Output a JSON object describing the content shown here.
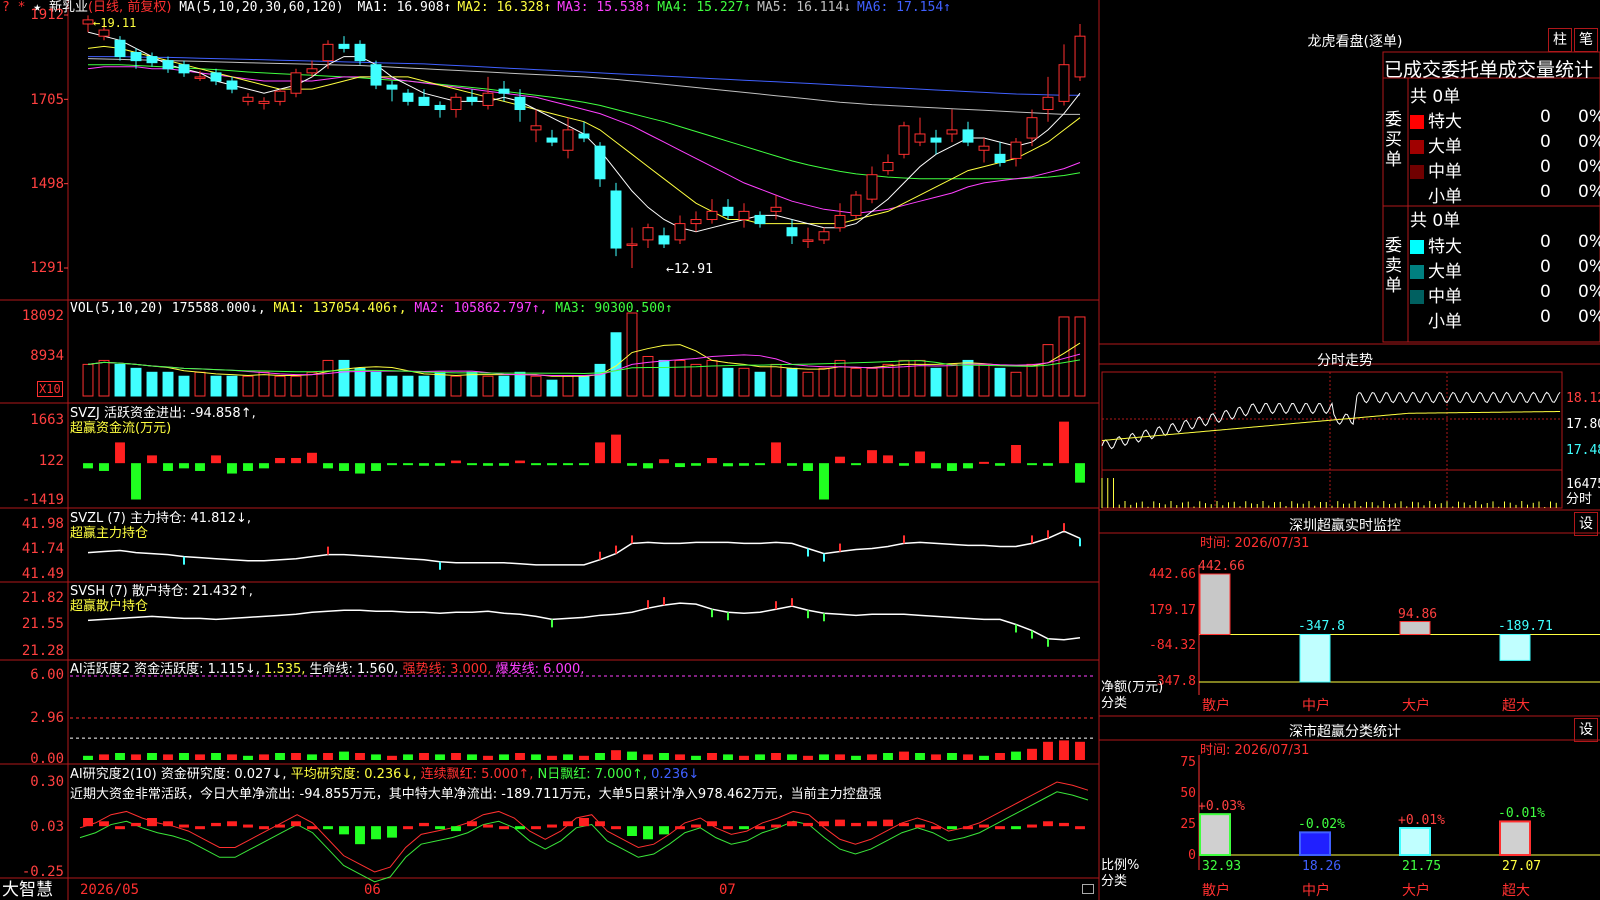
{
  "stock": {
    "name": "新乳业",
    "period": "(日线, 前复权)",
    "star": "★",
    "marks": "?  *"
  },
  "main_pane": {
    "ma_label": "MA(5,10,20,30,60,120)",
    "ma": [
      {
        "label": "MA1:",
        "value": "16.908↑",
        "color": "#ffffff"
      },
      {
        "label": "MA2:",
        "value": "16.328↑",
        "color": "#ffff40"
      },
      {
        "label": "MA3:",
        "value": "15.538↑",
        "color": "#ff40ff"
      },
      {
        "label": "MA4:",
        "value": "15.227↑",
        "color": "#40ff40"
      },
      {
        "label": "MA5:",
        "value": "16.114↓",
        "color": "#c0c0c0"
      },
      {
        "label": "MA6:",
        "value": "17.154↑",
        "color": "#4060ff"
      }
    ],
    "y_ticks": [
      "1912",
      "1705",
      "1498",
      "1291"
    ],
    "high_note": "19.11",
    "low_note": "←12.91"
  },
  "vol_pane": {
    "label": "VOL(5,10,20)",
    "value": "175588.000↓,",
    "ma1": "MA1: 137054.406↑,",
    "ma2": "MA2: 105862.797↑,",
    "ma3": "MA3: 90300.500↑",
    "y_ticks": [
      "18092",
      "8934"
    ],
    "unit": "X10"
  },
  "svzj_pane": {
    "line1": "SVZJ  活跃资金进出: -94.858↑,",
    "line2": "超赢资金流(万元)",
    "y_ticks": [
      "1663",
      "122",
      "-1419"
    ]
  },
  "svzl_pane": {
    "line1": "SVZL (7) 主力持仓: 41.812↓,",
    "line2": "超赢主力持仓",
    "y_ticks": [
      "41.98",
      "41.74",
      "41.49"
    ]
  },
  "svsh_pane": {
    "line1": "SVSH (7) 散户持仓: 21.432↑,",
    "line2": "超赢散户持仓",
    "y_ticks": [
      "21.82",
      "21.55",
      "21.28"
    ]
  },
  "ai1_pane": {
    "name": "AI活跃度2 资金活跃度: ",
    "v1": "1.115↓,",
    "v2": "1.535,",
    "life": "生命线: 1.560,",
    "strong": "强势线: 3.000,",
    "burst": "爆发线: 6.000,",
    "y_ticks": [
      "6.00",
      "2.96",
      "0.00"
    ]
  },
  "ai2_pane": {
    "name": "AI研究度2(10) 资金研究度: 0.027↓,",
    "avg": "平均研究度: 0.236↓,",
    "consecutive": "连续飘红: 5.000↑,",
    "nday": "N日飘红: 7.000↑,",
    "last": "0.236↓",
    "comment": "近期大资金非常活跃，今日大单净流出: -94.855万元，其中特大单净流出: -189.711万元，大单5日累计净入978.462万元，当前主力控盘强",
    "y_ticks": [
      "0.30",
      "0.03",
      "-0.25"
    ]
  },
  "footer": {
    "brand": "大智慧",
    "dates": [
      "2026/05",
      "06",
      "07"
    ]
  },
  "right_panel": {
    "lhb_title": "龙虎看盘(逐单)",
    "btn_bar": "柱",
    "btn_pen": "笔",
    "tabs_label": "已成交委托单成交量统计",
    "buy_label": "委买单",
    "sell_label": "委卖单",
    "buy_total": "共 0单",
    "sell_total": "共 0单",
    "buy_rows": [
      {
        "name": "特大",
        "count": "0",
        "pct": "0%",
        "color": "#ff0000"
      },
      {
        "name": "大单",
        "count": "0",
        "pct": "0%",
        "color": "#a00000"
      },
      {
        "name": "中单",
        "count": "0",
        "pct": "0%",
        "color": "#700000"
      },
      {
        "name": "小单",
        "count": "0",
        "pct": "0%",
        "color": "#000000"
      }
    ],
    "sell_rows": [
      {
        "name": "特大",
        "count": "0",
        "pct": "0%",
        "color": "#00ffff"
      },
      {
        "name": "大单",
        "count": "0",
        "pct": "0%",
        "color": "#008080"
      },
      {
        "name": "中单",
        "count": "0",
        "pct": "0%",
        "color": "#006060"
      },
      {
        "name": "小单",
        "count": "0",
        "pct": "0%",
        "color": "#000000"
      }
    ],
    "intraday_title": "分时走势",
    "intraday_ticks": [
      "18.12",
      "17.80",
      "17.48",
      "16475"
    ],
    "intraday_unit": "分时",
    "sz_title": "深圳超赢实时监控",
    "sz_setting": "设",
    "sz_time": "时间: 2026/07/31",
    "sz_ticks": [
      "442.66",
      "179.17",
      "-84.32",
      "-347.8"
    ],
    "sz_ylabel": "净额(万元)",
    "sz_xlabel": "分类",
    "sz_bars": [
      {
        "cat": "散户",
        "value": 442.66,
        "label": "442.66"
      },
      {
        "cat": "中户",
        "value": -347.8,
        "label": "-347.8"
      },
      {
        "cat": "大户",
        "value": 94.86,
        "label": "94.86"
      },
      {
        "cat": "超大",
        "value": -189.71,
        "label": "-189.71"
      }
    ],
    "cls_title": "深市超赢分类统计",
    "cls_setting": "设",
    "cls_time": "时间: 2026/07/31",
    "cls_ticks": [
      "75",
      "50",
      "25",
      "0"
    ],
    "cls_ylabel": "比例%",
    "cls_xlabel": "分类",
    "cls_bars": [
      {
        "cat": "散户",
        "value": 32.93,
        "delta": "+0.03%"
      },
      {
        "cat": "中户",
        "value": 18.26,
        "delta": "-0.02%"
      },
      {
        "cat": "大户",
        "value": 21.75,
        "delta": "+0.01%"
      },
      {
        "cat": "超大",
        "value": 27.07,
        "delta": "-0.01%"
      }
    ]
  },
  "chart_data": {
    "type": "candlestick",
    "candles": [
      [
        18.9,
        19.11,
        18.7,
        19.0
      ],
      [
        18.6,
        18.9,
        18.5,
        18.75
      ],
      [
        18.5,
        18.6,
        18.0,
        18.1
      ],
      [
        18.2,
        18.3,
        17.8,
        18.0
      ],
      [
        18.1,
        18.2,
        17.85,
        17.95
      ],
      [
        18.0,
        18.1,
        17.7,
        17.8
      ],
      [
        17.9,
        18.0,
        17.6,
        17.7
      ],
      [
        17.6,
        17.75,
        17.5,
        17.6
      ],
      [
        17.7,
        17.8,
        17.4,
        17.5
      ],
      [
        17.5,
        17.6,
        17.2,
        17.3
      ],
      [
        17.0,
        17.2,
        16.9,
        17.1
      ],
      [
        16.95,
        17.1,
        16.8,
        17.0
      ],
      [
        17.0,
        17.3,
        16.9,
        17.25
      ],
      [
        17.2,
        17.8,
        17.1,
        17.7
      ],
      [
        17.7,
        18.0,
        17.6,
        17.8
      ],
      [
        18.0,
        18.5,
        17.8,
        18.4
      ],
      [
        18.4,
        18.6,
        18.2,
        18.3
      ],
      [
        18.4,
        18.5,
        17.9,
        18.0
      ],
      [
        17.9,
        18.0,
        17.3,
        17.4
      ],
      [
        17.4,
        17.5,
        17.0,
        17.3
      ],
      [
        17.2,
        17.3,
        16.9,
        17.0
      ],
      [
        17.1,
        17.3,
        16.9,
        16.9
      ],
      [
        16.9,
        17.0,
        16.6,
        16.8
      ],
      [
        16.8,
        17.2,
        16.6,
        17.1
      ],
      [
        17.1,
        17.3,
        16.9,
        17.0
      ],
      [
        16.9,
        17.6,
        16.8,
        17.2
      ],
      [
        17.3,
        17.5,
        17.0,
        17.2
      ],
      [
        17.1,
        17.3,
        16.5,
        16.8
      ],
      [
        16.3,
        16.8,
        16.0,
        16.4
      ],
      [
        16.1,
        16.3,
        15.9,
        16.0
      ],
      [
        15.8,
        16.6,
        15.6,
        16.3
      ],
      [
        16.2,
        16.5,
        16.0,
        16.1
      ],
      [
        15.9,
        16.0,
        14.9,
        15.1
      ],
      [
        14.8,
        15.0,
        13.2,
        13.4
      ],
      [
        13.5,
        13.9,
        12.91,
        13.5
      ],
      [
        13.6,
        14.0,
        13.4,
        13.9
      ],
      [
        13.7,
        13.9,
        13.4,
        13.5
      ],
      [
        13.6,
        14.2,
        13.5,
        14.0
      ],
      [
        14.0,
        14.3,
        13.8,
        14.1
      ],
      [
        14.1,
        14.6,
        14.0,
        14.3
      ],
      [
        14.4,
        14.6,
        14.1,
        14.2
      ],
      [
        14.1,
        14.5,
        13.9,
        14.3
      ],
      [
        14.2,
        14.3,
        13.9,
        14.0
      ],
      [
        14.3,
        14.7,
        14.1,
        14.4
      ],
      [
        13.9,
        14.1,
        13.5,
        13.7
      ],
      [
        13.6,
        13.9,
        13.4,
        13.6
      ],
      [
        13.6,
        13.9,
        13.5,
        13.8
      ],
      [
        13.9,
        14.5,
        13.8,
        14.2
      ],
      [
        14.2,
        14.8,
        14.1,
        14.7
      ],
      [
        14.6,
        15.4,
        14.5,
        15.2
      ],
      [
        15.3,
        15.7,
        15.2,
        15.5
      ],
      [
        15.7,
        16.5,
        15.6,
        16.4
      ],
      [
        16.0,
        16.6,
        15.9,
        16.2
      ],
      [
        16.1,
        16.3,
        15.7,
        16.0
      ],
      [
        16.2,
        16.8,
        16.0,
        16.3
      ],
      [
        16.3,
        16.5,
        15.9,
        16.0
      ],
      [
        15.8,
        16.1,
        15.5,
        15.9
      ],
      [
        15.7,
        16.0,
        15.4,
        15.5
      ],
      [
        15.6,
        16.1,
        15.4,
        16.0
      ],
      [
        16.1,
        16.8,
        15.9,
        16.6
      ],
      [
        16.8,
        17.6,
        16.5,
        17.1
      ],
      [
        17.0,
        18.4,
        16.9,
        17.9
      ],
      [
        17.6,
        18.9,
        17.5,
        18.6
      ]
    ],
    "ma5": [
      18.7,
      18.6,
      18.5,
      18.3,
      18.1,
      17.9,
      17.8,
      17.7,
      17.5,
      17.4,
      17.3,
      17.2,
      17.3,
      17.4,
      17.6,
      17.9,
      18.1,
      18.1,
      17.9,
      17.6,
      17.4,
      17.2,
      17.1,
      17.0,
      17.0,
      17.0,
      17.1,
      17.0,
      16.8,
      16.6,
      16.4,
      16.2,
      15.8,
      15.3,
      14.8,
      14.4,
      14.1,
      13.9,
      13.8,
      13.9,
      14.0,
      14.1,
      14.2,
      14.2,
      14.1,
      14.0,
      13.9,
      13.9,
      14.0,
      14.3,
      14.6,
      15.0,
      15.4,
      15.7,
      15.9,
      16.1,
      16.1,
      16.0,
      15.9,
      16.0,
      16.3,
      16.7,
      17.2
    ],
    "ma10": [
      18.3,
      18.35,
      18.3,
      18.2,
      18.1,
      18.0,
      17.9,
      17.8,
      17.7,
      17.6,
      17.5,
      17.4,
      17.3,
      17.3,
      17.3,
      17.4,
      17.5,
      17.6,
      17.6,
      17.6,
      17.6,
      17.5,
      17.4,
      17.3,
      17.2,
      17.1,
      17.0,
      16.9,
      16.8,
      16.7,
      16.6,
      16.5,
      16.3,
      16.0,
      15.7,
      15.4,
      15.1,
      14.8,
      14.5,
      14.3,
      14.1,
      14.1,
      14.0,
      14.0,
      14.0,
      14.0,
      14.0,
      14.0,
      14.1,
      14.2,
      14.3,
      14.5,
      14.7,
      14.9,
      15.1,
      15.3,
      15.4,
      15.5,
      15.6,
      15.8,
      16.0,
      16.3,
      16.6
    ],
    "ma20": [
      17.8,
      17.85,
      17.85,
      17.85,
      17.8,
      17.8,
      17.75,
      17.7,
      17.65,
      17.6,
      17.55,
      17.5,
      17.5,
      17.5,
      17.5,
      17.55,
      17.6,
      17.6,
      17.6,
      17.55,
      17.5,
      17.45,
      17.4,
      17.35,
      17.3,
      17.25,
      17.2,
      17.15,
      17.1,
      17.0,
      16.9,
      16.8,
      16.7,
      16.55,
      16.4,
      16.2,
      16.0,
      15.8,
      15.6,
      15.4,
      15.2,
      15.0,
      14.85,
      14.7,
      14.55,
      14.45,
      14.35,
      14.3,
      14.25,
      14.3,
      14.35,
      14.45,
      14.55,
      14.65,
      14.75,
      14.9,
      15.0,
      15.05,
      15.1,
      15.15,
      15.25,
      15.35,
      15.5
    ],
    "ma30": [
      17.9,
      17.9,
      17.9,
      17.88,
      17.86,
      17.84,
      17.82,
      17.8,
      17.78,
      17.75,
      17.72,
      17.7,
      17.68,
      17.66,
      17.64,
      17.62,
      17.6,
      17.58,
      17.55,
      17.52,
      17.5,
      17.46,
      17.42,
      17.38,
      17.34,
      17.3,
      17.25,
      17.2,
      17.15,
      17.1,
      17.04,
      16.98,
      16.9,
      16.8,
      16.7,
      16.6,
      16.5,
      16.38,
      16.26,
      16.14,
      16.02,
      15.9,
      15.78,
      15.66,
      15.54,
      15.44,
      15.36,
      15.28,
      15.22,
      15.18,
      15.14,
      15.12,
      15.1,
      15.1,
      15.1,
      15.1,
      15.1,
      15.1,
      15.1,
      15.12,
      15.14,
      15.18,
      15.25
    ],
    "ma60": [
      18.05,
      18.04,
      18.03,
      18.02,
      18.01,
      18.0,
      17.99,
      17.98,
      17.97,
      17.96,
      17.95,
      17.94,
      17.93,
      17.92,
      17.91,
      17.9,
      17.89,
      17.88,
      17.86,
      17.84,
      17.82,
      17.8,
      17.78,
      17.76,
      17.74,
      17.72,
      17.7,
      17.68,
      17.66,
      17.64,
      17.62,
      17.6,
      17.57,
      17.54,
      17.5,
      17.46,
      17.42,
      17.38,
      17.34,
      17.3,
      17.26,
      17.22,
      17.18,
      17.14,
      17.1,
      17.06,
      17.02,
      16.98,
      16.95,
      16.92,
      16.9,
      16.88,
      16.86,
      16.84,
      16.82,
      16.8,
      16.78,
      16.76,
      16.74,
      16.72,
      16.7,
      16.68,
      16.68
    ],
    "ma120": [
      18.1,
      18.1,
      18.1,
      18.09,
      18.08,
      18.08,
      18.07,
      18.06,
      18.05,
      18.04,
      18.03,
      18.02,
      18.01,
      18.0,
      17.99,
      17.98,
      17.97,
      17.96,
      17.95,
      17.94,
      17.93,
      17.92,
      17.9,
      17.88,
      17.86,
      17.84,
      17.82,
      17.8,
      17.78,
      17.76,
      17.74,
      17.72,
      17.7,
      17.68,
      17.66,
      17.64,
      17.62,
      17.6,
      17.58,
      17.56,
      17.54,
      17.52,
      17.5,
      17.48,
      17.46,
      17.44,
      17.42,
      17.4,
      17.38,
      17.36,
      17.34,
      17.32,
      17.3,
      17.28,
      17.26,
      17.24,
      17.22,
      17.2,
      17.18,
      17.17,
      17.16,
      17.15,
      17.15
    ],
    "volume": [
      8,
      9,
      8,
      7,
      6,
      6,
      5,
      6,
      5,
      5,
      5,
      6,
      5,
      5,
      6,
      9,
      9,
      7,
      6,
      5,
      5,
      5,
      6,
      5,
      6,
      5,
      5,
      6,
      5,
      4,
      5,
      5,
      8,
      16,
      21,
      10,
      9,
      9,
      8,
      9,
      7,
      7,
      6,
      8,
      7,
      6,
      7,
      9,
      7,
      7,
      8,
      9,
      9,
      7,
      8,
      9,
      8,
      7,
      6,
      8,
      13,
      20,
      20
    ],
    "svzj": [
      -200,
      -300,
      800,
      -1400,
      300,
      -300,
      -200,
      -300,
      300,
      -400,
      -300,
      -200,
      200,
      200,
      400,
      -200,
      -300,
      -400,
      -300,
      -50,
      -40,
      -100,
      -100,
      100,
      -50,
      -100,
      -100,
      100,
      -50,
      -80,
      -40,
      -30,
      800,
      1100,
      -100,
      -200,
      150,
      -150,
      -100,
      200,
      -120,
      -100,
      -60,
      800,
      -100,
      -300,
      -1400,
      250,
      -50,
      500,
      300,
      -100,
      450,
      -200,
      -300,
      -200,
      50,
      -100,
      700,
      -50,
      -100,
      1600,
      -750,
      -200
    ],
    "svzl": [
      41.7,
      41.71,
      41.72,
      41.7,
      41.69,
      41.68,
      41.66,
      41.65,
      41.64,
      41.63,
      41.62,
      41.62,
      41.63,
      41.64,
      41.66,
      41.68,
      41.68,
      41.67,
      41.66,
      41.65,
      41.64,
      41.63,
      41.61,
      41.6,
      41.6,
      41.6,
      41.6,
      41.59,
      41.58,
      41.58,
      41.58,
      41.58,
      41.63,
      41.69,
      41.79,
      41.8,
      41.79,
      41.79,
      41.8,
      41.8,
      41.8,
      41.79,
      41.79,
      41.8,
      41.79,
      41.74,
      41.69,
      41.71,
      41.73,
      41.74,
      41.76,
      41.79,
      41.8,
      41.79,
      41.78,
      41.77,
      41.77,
      41.76,
      41.76,
      41.79,
      41.84,
      41.91,
      41.84,
      41.82
    ],
    "svsh": [
      21.6,
      21.61,
      21.62,
      21.63,
      21.64,
      21.63,
      21.62,
      21.62,
      21.61,
      21.62,
      21.63,
      21.64,
      21.65,
      21.66,
      21.68,
      21.69,
      21.7,
      21.7,
      21.69,
      21.69,
      21.68,
      21.68,
      21.67,
      21.68,
      21.68,
      21.69,
      21.67,
      21.66,
      21.64,
      21.61,
      21.62,
      21.63,
      21.65,
      21.66,
      21.68,
      21.72,
      21.75,
      21.77,
      21.76,
      21.71,
      21.68,
      21.67,
      21.68,
      21.71,
      21.74,
      21.7,
      21.67,
      21.66,
      21.65,
      21.66,
      21.66,
      21.66,
      21.65,
      21.64,
      21.63,
      21.62,
      21.61,
      21.61,
      21.56,
      21.5,
      21.42,
      21.41,
      21.43
    ],
    "ai1": [
      0.3,
      0.4,
      0.5,
      0.4,
      0.5,
      0.4,
      0.5,
      0.4,
      0.5,
      0.4,
      0.3,
      0.4,
      0.5,
      0.5,
      0.4,
      0.5,
      0.6,
      0.5,
      0.4,
      0.3,
      0.4,
      0.5,
      0.4,
      0.5,
      0.4,
      0.3,
      0.4,
      0.5,
      0.4,
      0.3,
      0.4,
      0.3,
      0.5,
      0.7,
      0.6,
      0.4,
      0.5,
      0.4,
      0.3,
      0.5,
      0.4,
      0.3,
      0.4,
      0.5,
      0.4,
      0.3,
      0.4,
      0.4,
      0.3,
      0.4,
      0.5,
      0.6,
      0.5,
      0.4,
      0.5,
      0.4,
      0.3,
      0.5,
      0.6,
      0.8,
      1.3,
      1.4,
      1.3,
      1.1
    ],
    "ai2": [
      0.08,
      0.06,
      0.03,
      0.05,
      0.08,
      0.06,
      0.04,
      0.03,
      0.05,
      0.06,
      0.04,
      0.03,
      0.04,
      0.06,
      0.03,
      0.02,
      -0.02,
      -0.08,
      -0.05,
      -0.04,
      0.03,
      0.05,
      0.02,
      0.0,
      0.06,
      0.04,
      0.03,
      0.02,
      0.03,
      0.04,
      0.06,
      0.08,
      0.06,
      0.03,
      -0.03,
      -0.05,
      -0.02,
      0.03,
      0.04,
      0.06,
      0.03,
      0.02,
      0.03,
      0.04,
      0.06,
      0.05,
      0.06,
      0.07,
      0.05,
      0.06,
      0.07,
      0.05,
      0.04,
      0.03,
      0.02,
      0.03,
      0.04,
      0.03,
      0.02,
      0.04,
      0.06,
      0.05,
      0.03,
      0.03
    ],
    "ai2_line": [
      0.02,
      0.05,
      0.1,
      0.12,
      0.08,
      0.05,
      0.03,
      0.0,
      -0.05,
      -0.1,
      -0.1,
      -0.05,
      0.0,
      0.05,
      0.1,
      0.05,
      -0.05,
      -0.15,
      -0.2,
      -0.25,
      -0.22,
      -0.1,
      -0.02,
      0.0,
      0.02,
      0.05,
      0.1,
      0.12,
      0.08,
      0.0,
      -0.05,
      0.0,
      0.08,
      0.1,
      0.0,
      -0.05,
      -0.1,
      -0.08,
      -0.02,
      0.05,
      0.08,
      0.02,
      -0.02,
      0.0,
      0.05,
      0.08,
      0.12,
      0.1,
      0.02,
      -0.05,
      -0.08,
      -0.05,
      0.0,
      0.05,
      0.08,
      0.05,
      0.0,
      0.02,
      0.05,
      0.1,
      0.15,
      0.2,
      0.25,
      0.3,
      0.28,
      0.25
    ]
  }
}
